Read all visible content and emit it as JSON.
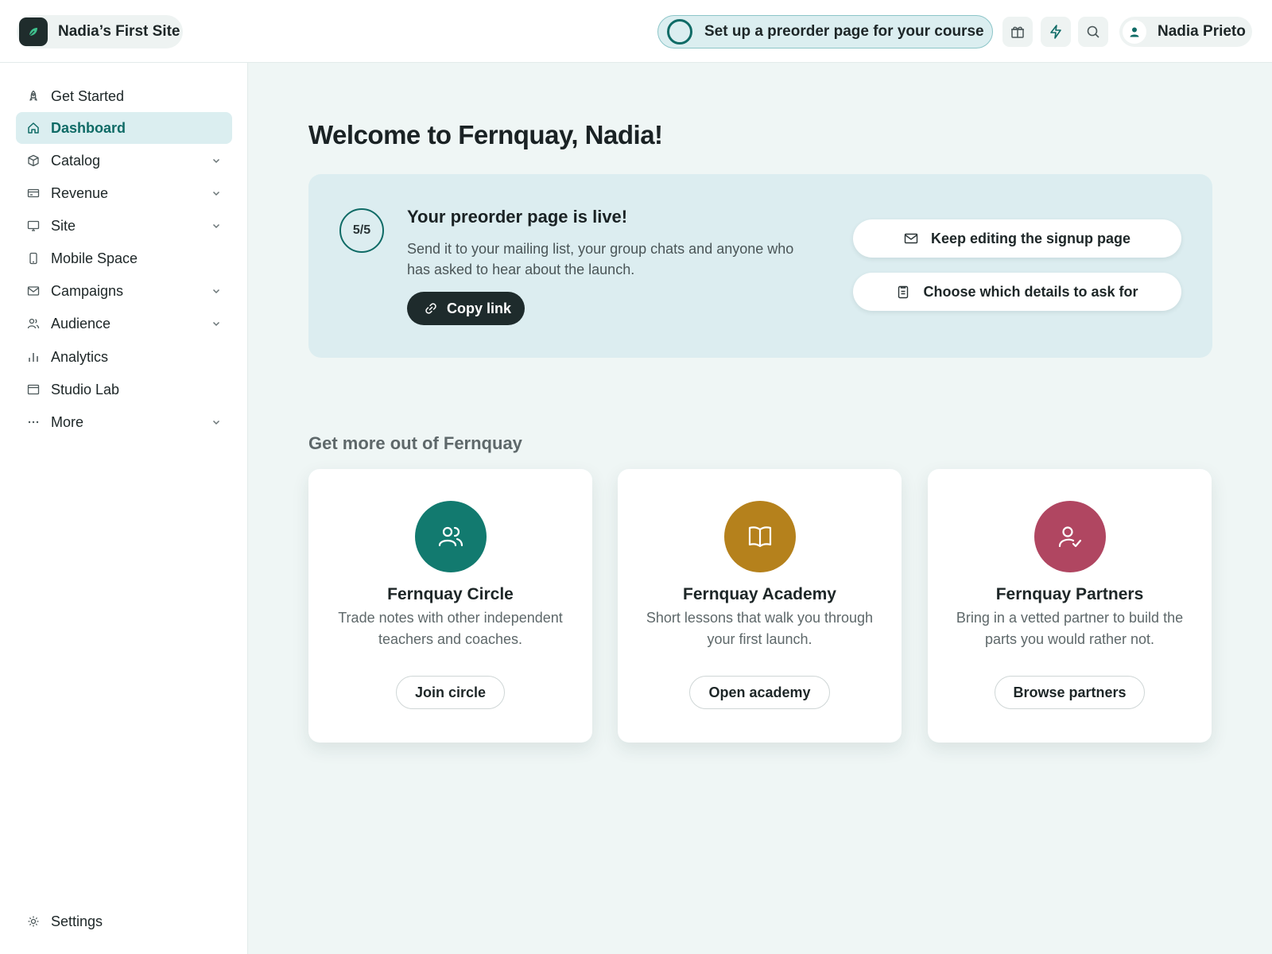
{
  "app": {
    "site_name": "Nadia’s First Site"
  },
  "header": {
    "task_label": "Set up a preorder page for your course",
    "user_name": "Nadia Prieto",
    "icons": [
      "gift-icon",
      "lightning-icon",
      "search-icon"
    ]
  },
  "sidebar": {
    "items": [
      {
        "label": "Get Started",
        "icon": "rocket-icon",
        "expandable": false,
        "active": false
      },
      {
        "label": "Dashboard",
        "icon": "home-icon",
        "expandable": false,
        "active": true
      },
      {
        "label": "Catalog",
        "icon": "box-icon",
        "expandable": true,
        "active": false
      },
      {
        "label": "Revenue",
        "icon": "credit-card-icon",
        "expandable": true,
        "active": false
      },
      {
        "label": "Site",
        "icon": "monitor-icon",
        "expandable": true,
        "active": false
      },
      {
        "label": "Mobile Space",
        "icon": "phone-icon",
        "expandable": false,
        "active": false
      },
      {
        "label": "Campaigns",
        "icon": "mail-icon",
        "expandable": true,
        "active": false
      },
      {
        "label": "Audience",
        "icon": "users-icon",
        "expandable": true,
        "active": false
      },
      {
        "label": "Analytics",
        "icon": "bar-chart-icon",
        "expandable": false,
        "active": false
      },
      {
        "label": "Studio Lab",
        "icon": "window-icon",
        "expandable": false,
        "active": false
      },
      {
        "label": "More",
        "icon": "ellipsis-icon",
        "expandable": true,
        "active": false
      }
    ],
    "settings_label": "Settings"
  },
  "main": {
    "welcome": "Welcome to Fernquay, Nadia!",
    "hero": {
      "progress": "5/5",
      "title": "Your preorder page is live!",
      "description": "Send it to your mailing list, your group chats and anyone who has asked to hear about the launch.",
      "copy_label": "Copy link",
      "actions": [
        {
          "label": "Keep editing the signup page",
          "icon": "mail-icon"
        },
        {
          "label": "Choose which details to ask for",
          "icon": "clipboard-icon"
        }
      ]
    },
    "section_title": "Get more out of Fernquay",
    "cards": [
      {
        "title": "Fernquay Circle",
        "description": "Trade notes with other independent teachers and coaches.",
        "button": "Join circle",
        "icon": "users-icon",
        "color": "#127a6f"
      },
      {
        "title": "Fernquay Academy",
        "description": "Short lessons that walk you through your first launch.",
        "button": "Open academy",
        "icon": "book-icon",
        "color": "#b5811c"
      },
      {
        "title": "Fernquay Partners",
        "description": "Bring in a vetted partner to build the parts you would rather not.",
        "button": "Browse partners",
        "icon": "user-check-icon",
        "color": "#b04661"
      }
    ]
  }
}
